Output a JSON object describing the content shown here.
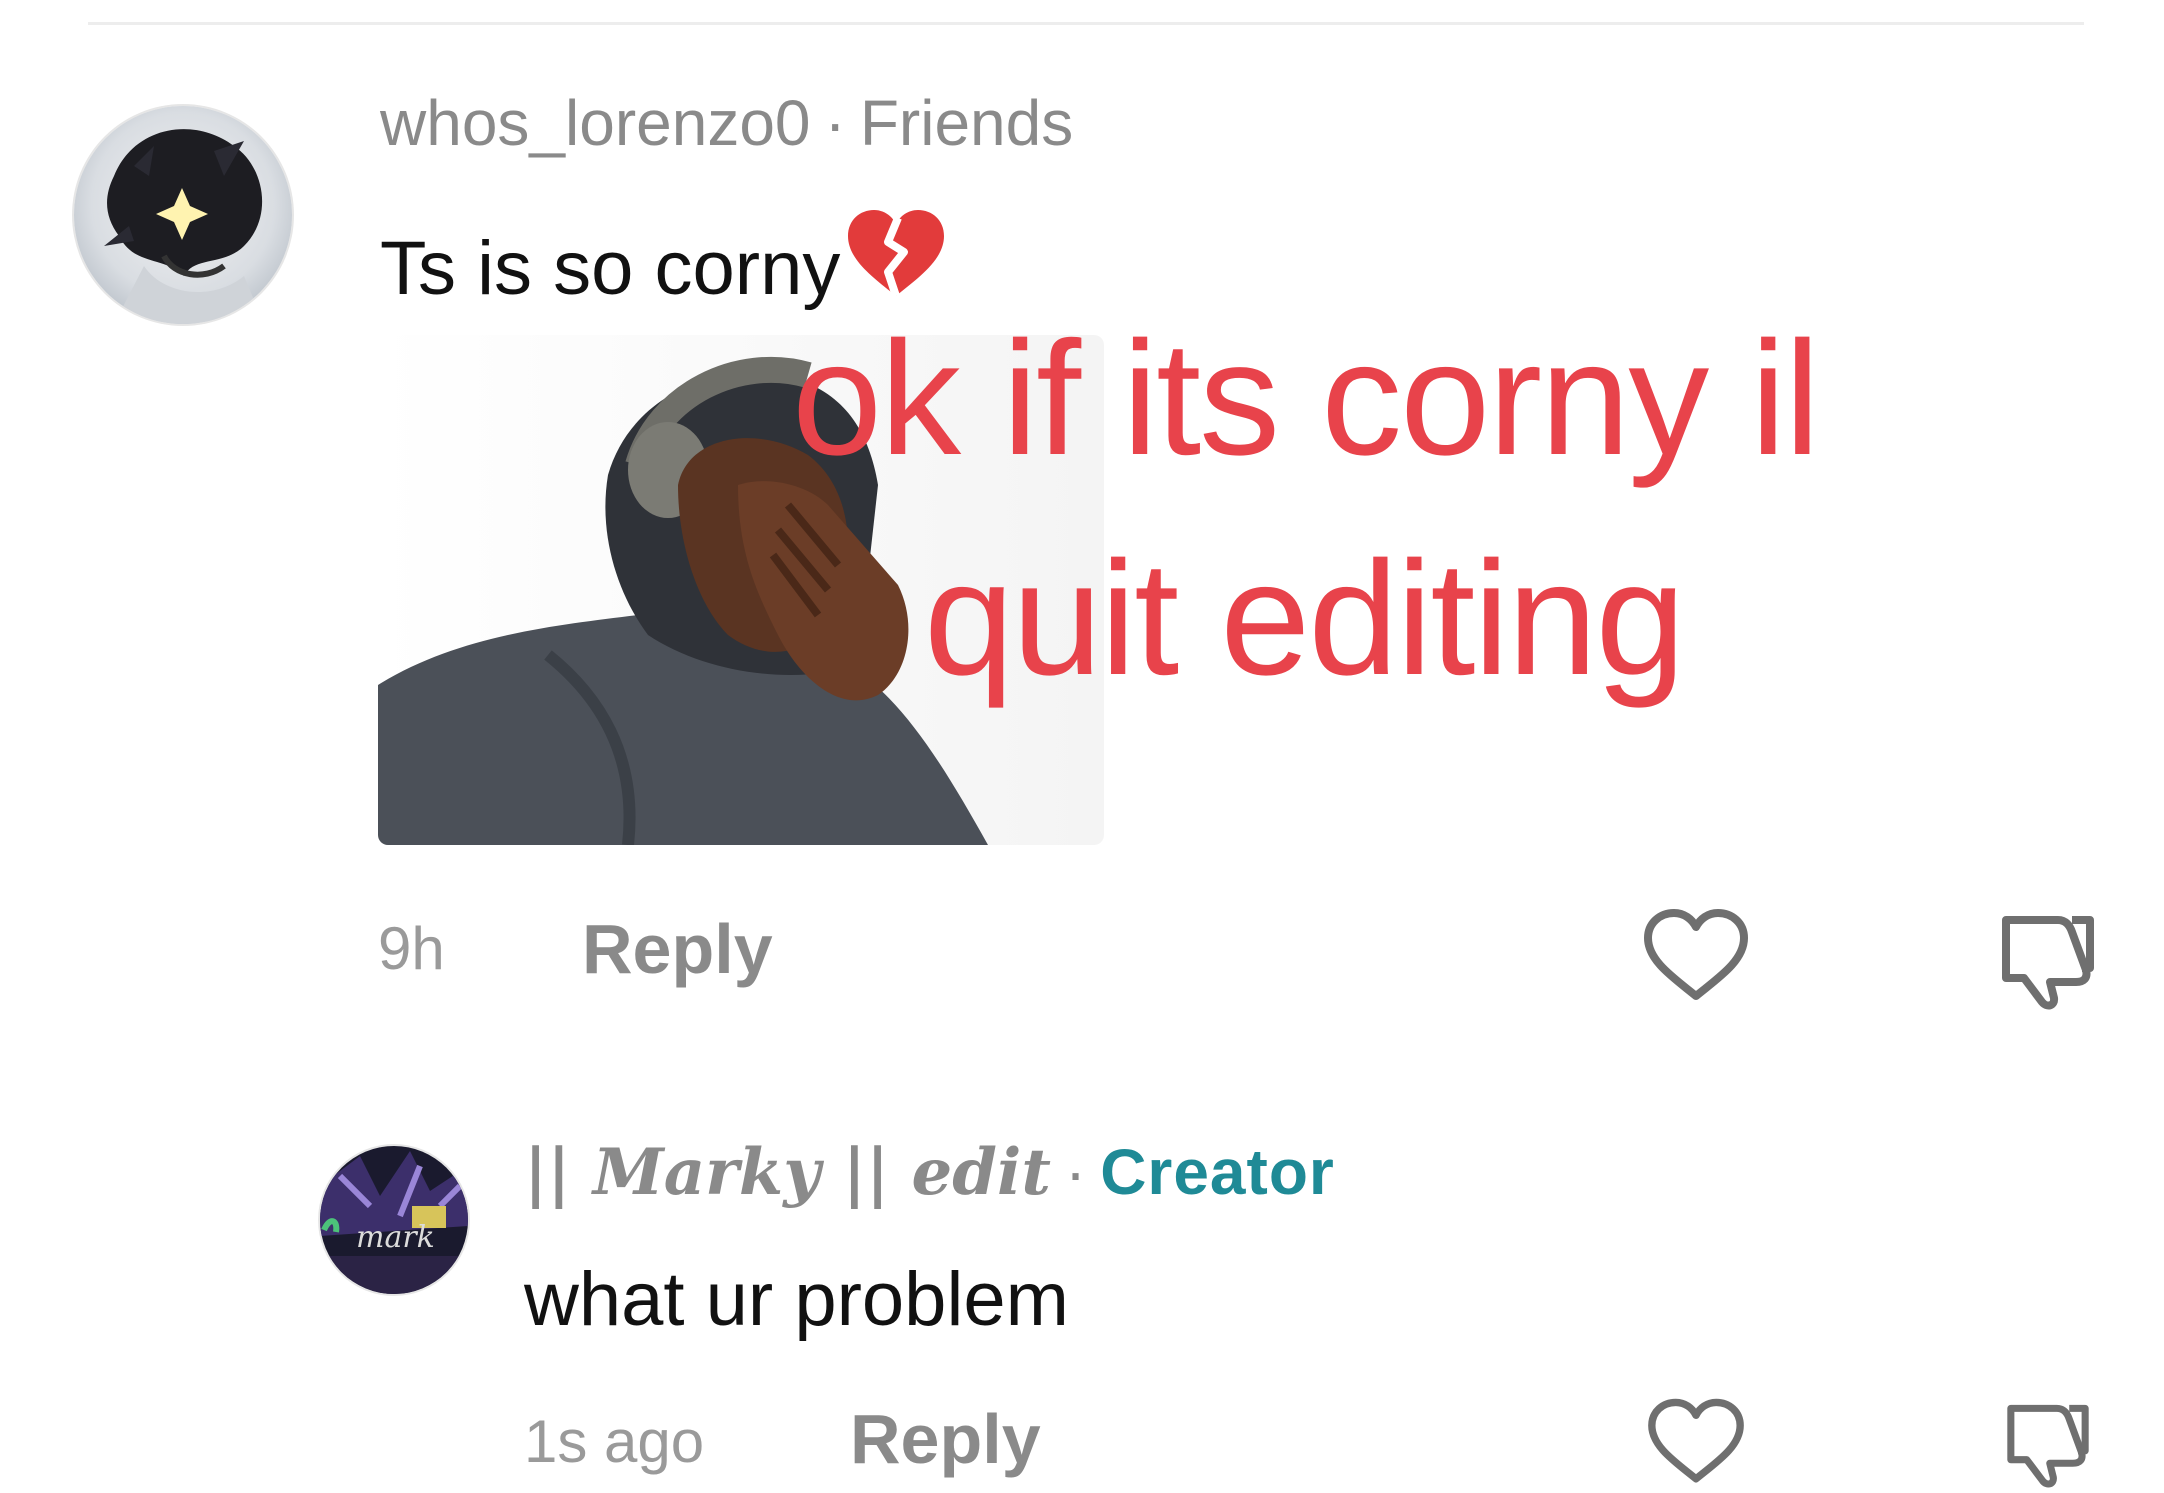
{
  "comment1": {
    "username": "whos_lorenzo0",
    "separator": "·",
    "relation": "Friends",
    "text": "Ts is so corny",
    "emoji": "broken-heart",
    "overlay_line1": "ok if its corny il",
    "overlay_line2": "quit editing",
    "time": "9h",
    "reply_label": "Reply"
  },
  "comment2": {
    "username": "|| Marky || edit",
    "separator": "·",
    "relation": "Creator",
    "text": "what ur problem",
    "time": "1s ago",
    "reply_label": "Reply",
    "avatar_text": "mark"
  },
  "colors": {
    "creator": "#1f8a96",
    "overlay": "#e8434b",
    "muted": "#8a8a8a"
  },
  "icons": [
    "heart-outline-icon",
    "thumbs-down-icon"
  ]
}
